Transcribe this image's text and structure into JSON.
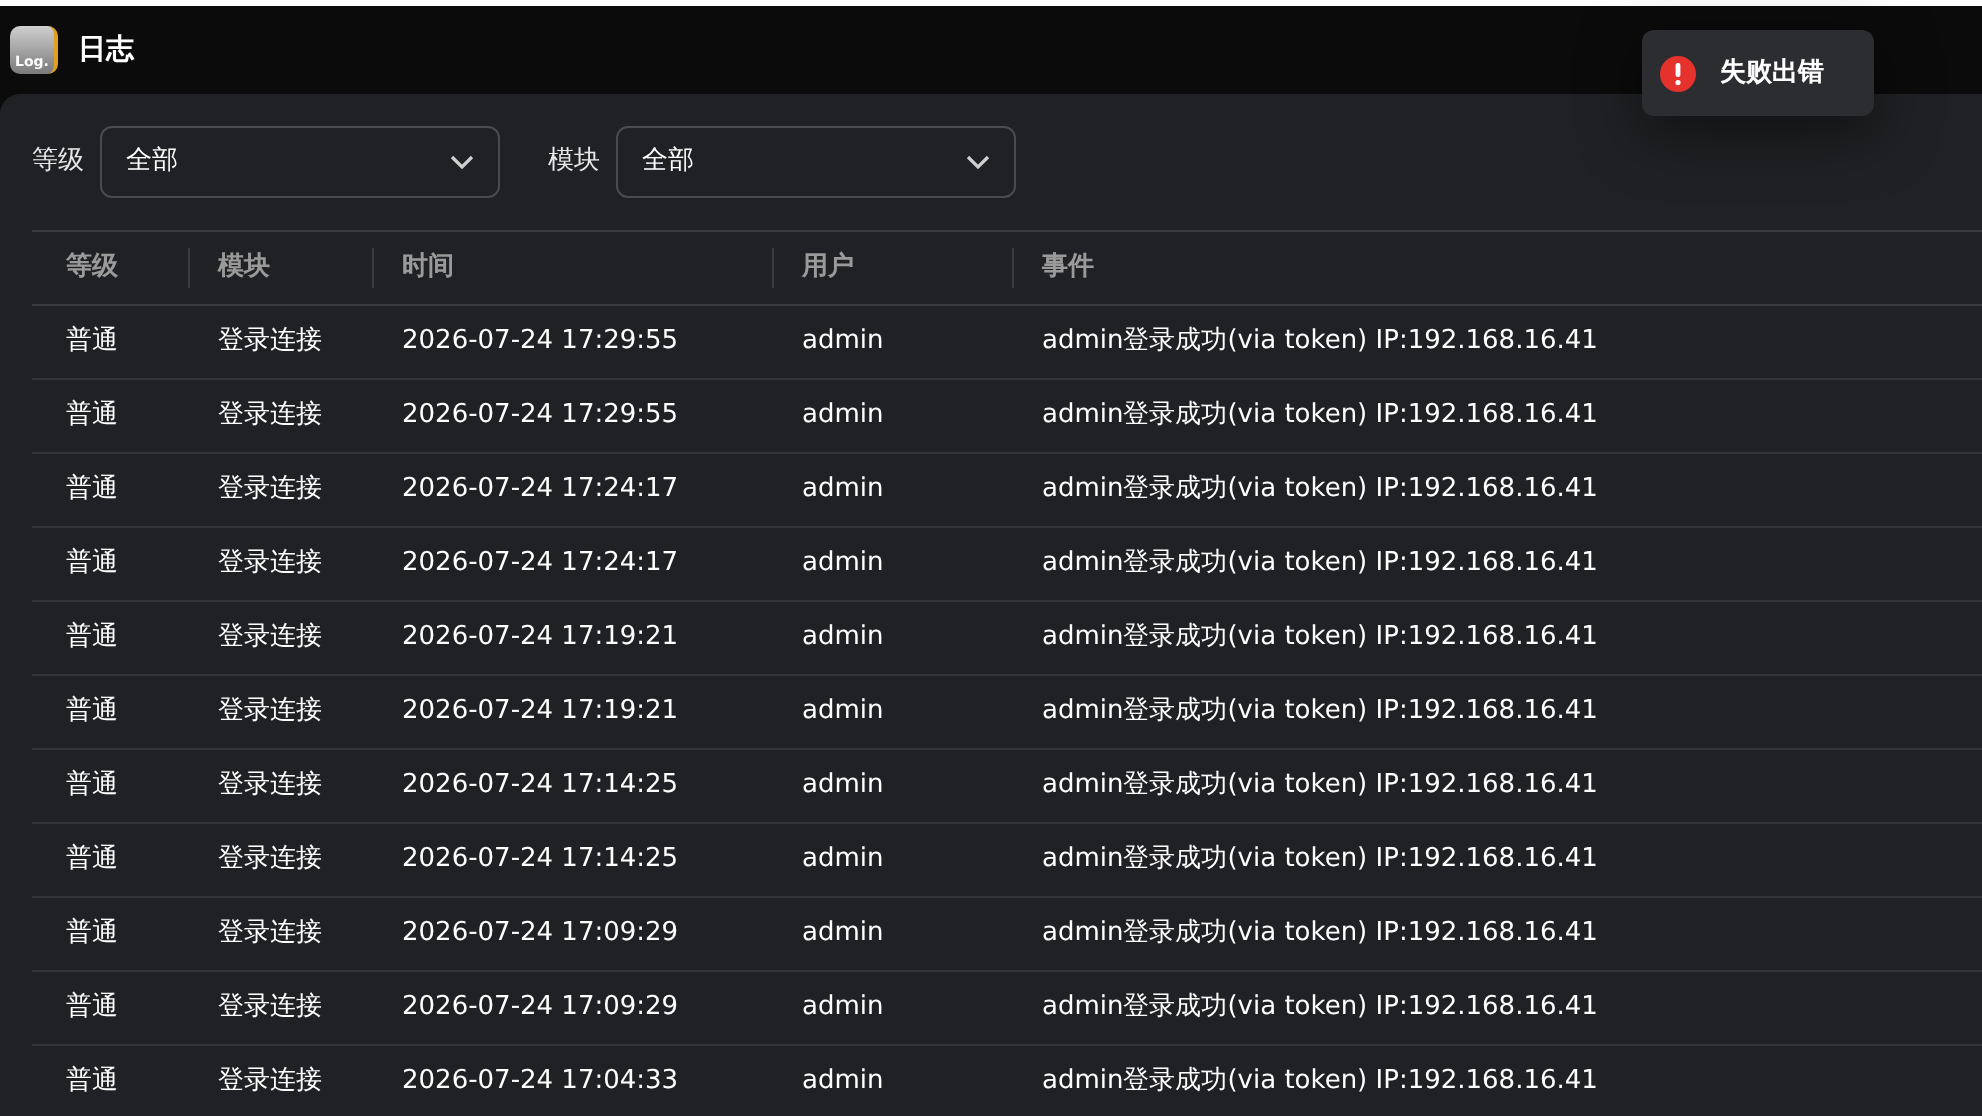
{
  "window": {
    "title": "日志",
    "app_icon_label": "Log."
  },
  "toast": {
    "kind": "error",
    "message": "失败出错"
  },
  "filters": [
    {
      "label": "等级",
      "value": "全部"
    },
    {
      "label": "模块",
      "value": "全部"
    }
  ],
  "table": {
    "columns": [
      "等级",
      "模块",
      "时间",
      "用户",
      "事件"
    ],
    "rows": [
      [
        "普通",
        "登录连接",
        "2026-07-24 17:29:55",
        "admin",
        "admin登录成功(via token) IP:192.168.16.41"
      ],
      [
        "普通",
        "登录连接",
        "2026-07-24 17:29:55",
        "admin",
        "admin登录成功(via token) IP:192.168.16.41"
      ],
      [
        "普通",
        "登录连接",
        "2026-07-24 17:24:17",
        "admin",
        "admin登录成功(via token) IP:192.168.16.41"
      ],
      [
        "普通",
        "登录连接",
        "2026-07-24 17:24:17",
        "admin",
        "admin登录成功(via token) IP:192.168.16.41"
      ],
      [
        "普通",
        "登录连接",
        "2026-07-24 17:19:21",
        "admin",
        "admin登录成功(via token) IP:192.168.16.41"
      ],
      [
        "普通",
        "登录连接",
        "2026-07-24 17:19:21",
        "admin",
        "admin登录成功(via token) IP:192.168.16.41"
      ],
      [
        "普通",
        "登录连接",
        "2026-07-24 17:14:25",
        "admin",
        "admin登录成功(via token) IP:192.168.16.41"
      ],
      [
        "普通",
        "登录连接",
        "2026-07-24 17:14:25",
        "admin",
        "admin登录成功(via token) IP:192.168.16.41"
      ],
      [
        "普通",
        "登录连接",
        "2026-07-24 17:09:29",
        "admin",
        "admin登录成功(via token) IP:192.168.16.41"
      ],
      [
        "普通",
        "登录连接",
        "2026-07-24 17:09:29",
        "admin",
        "admin登录成功(via token) IP:192.168.16.41"
      ],
      [
        "普通",
        "登录连接",
        "2026-07-24 17:04:33",
        "admin",
        "admin登录成功(via token) IP:192.168.16.41"
      ]
    ]
  }
}
